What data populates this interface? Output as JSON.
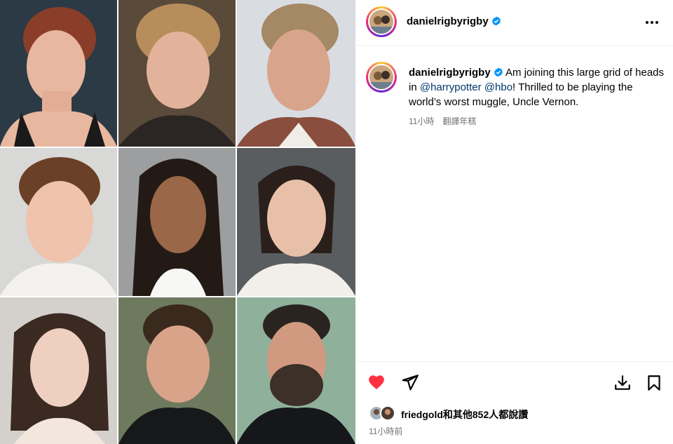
{
  "post": {
    "username": "danielrigbyrigby",
    "more_icon": "more-horizontal-icon"
  },
  "caption": {
    "username": "danielrigbyrigby",
    "text_1": " Am joining this large grid of heads in ",
    "mention_1": "@harrypotter",
    "mention_2": "@hbo",
    "text_2": "! Thrilled to be playing the world’s worst muggle, Uncle Vernon.",
    "time": "11小時",
    "translate": "翻譯年糕"
  },
  "actions": {
    "like_icon": "heart-icon-filled",
    "share_icon": "send-icon",
    "save_icon": "bookmark-icon",
    "download_icon": "download-icon"
  },
  "likes": {
    "text": "friedgold和其他852人都說讚"
  },
  "timestamp": "11小時前",
  "colors": {
    "like_red": "#ff3040",
    "link": "#00376b",
    "verified_blue": "#0095f6",
    "meta_grey": "#737373"
  }
}
